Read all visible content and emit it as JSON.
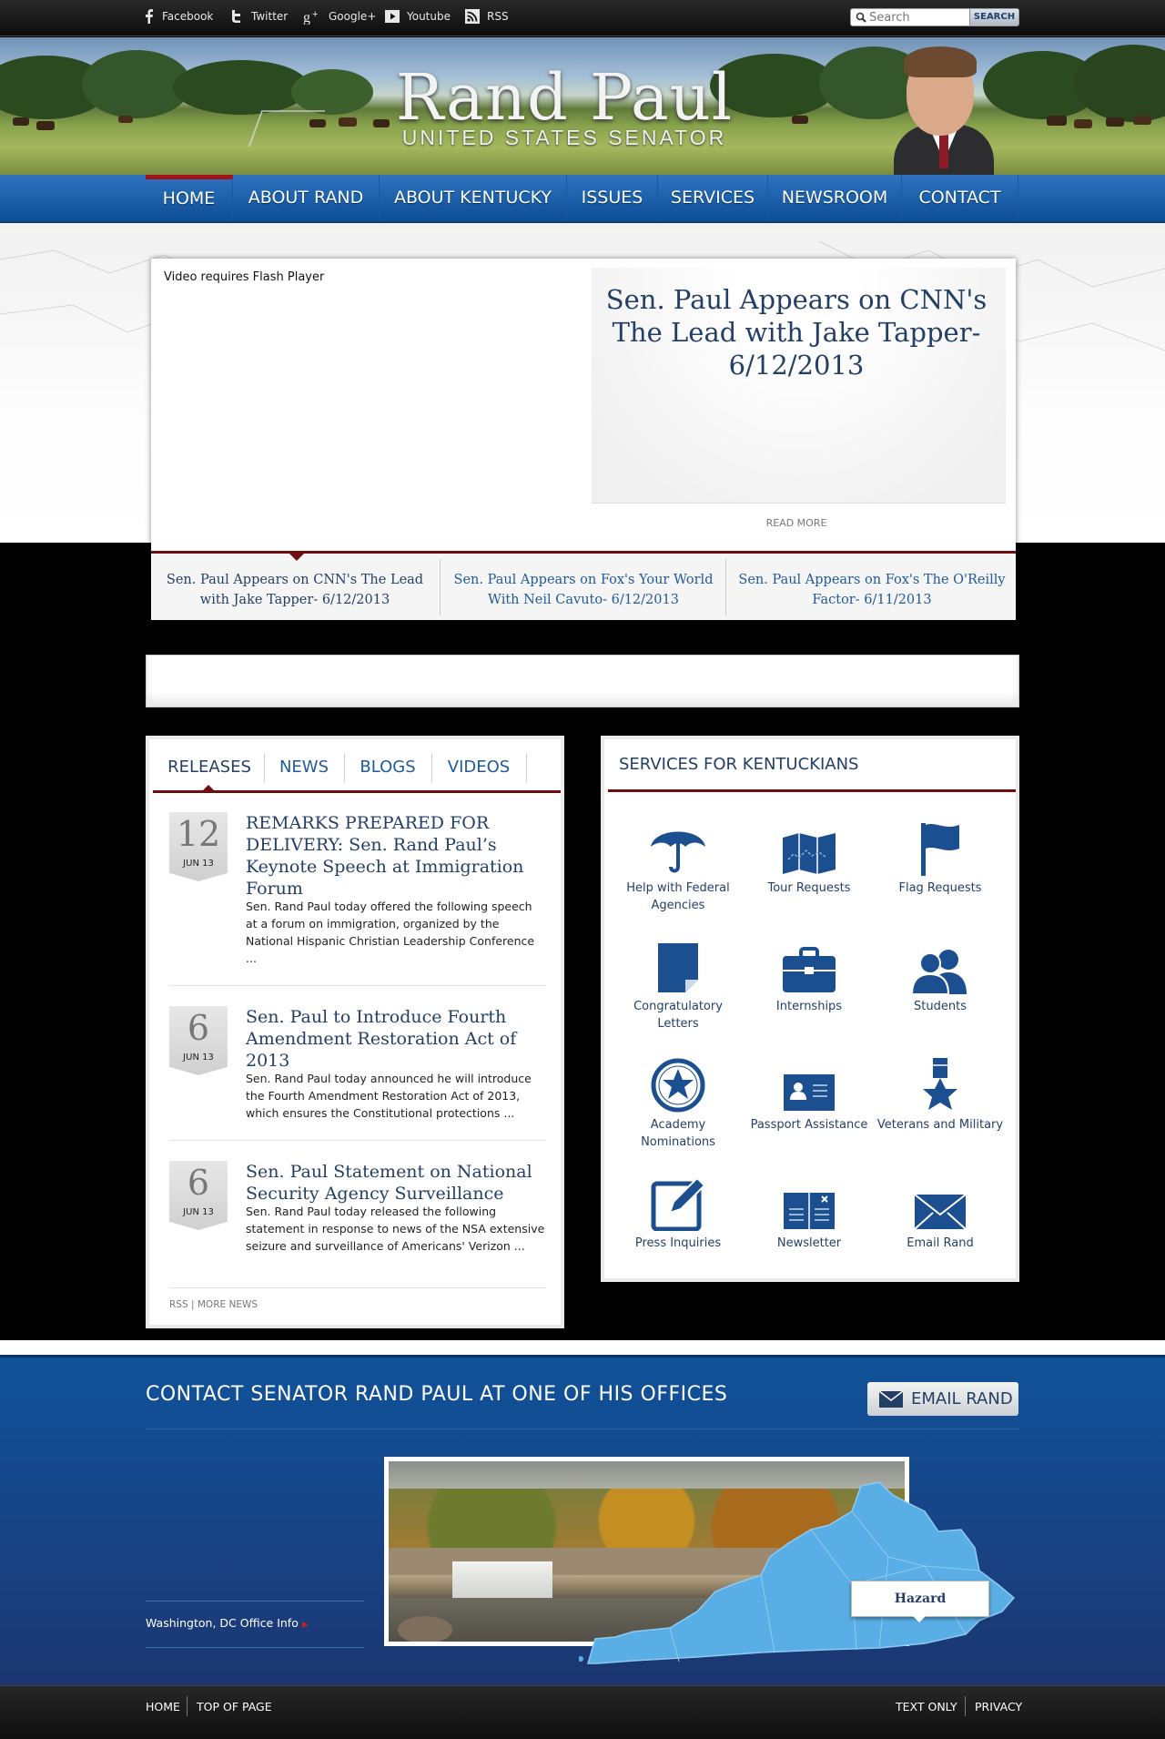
{
  "topbar": {
    "social": [
      {
        "label": "Facebook",
        "icon": "facebook-icon"
      },
      {
        "label": "Twitter",
        "icon": "twitter-icon"
      },
      {
        "label": "Google+",
        "icon": "google-plus-icon"
      },
      {
        "label": "Youtube",
        "icon": "youtube-icon"
      },
      {
        "label": "RSS",
        "icon": "rss-icon"
      }
    ],
    "search_placeholder": "Search",
    "search_button": "SEARCH"
  },
  "header": {
    "title": "Rand Paul",
    "subtitle": "UNITED STATES SENATOR"
  },
  "nav": {
    "items": [
      "HOME",
      "ABOUT RAND",
      "ABOUT KENTUCKY",
      "ISSUES",
      "SERVICES",
      "NEWSROOM",
      "CONTACT"
    ],
    "active": "HOME"
  },
  "feature": {
    "flash_notice": "Video requires Flash Player",
    "title": "Sen. Paul Appears on CNN's The Lead with Jake Tapper- 6/12/2013",
    "read_more": "READ MORE",
    "tabs": [
      "Sen. Paul Appears on CNN's The Lead with Jake Tapper- 6/12/2013",
      "Sen. Paul Appears on Fox's Your World With Neil Cavuto- 6/12/2013",
      "Sen. Paul Appears on Fox's The O'Reilly Factor- 6/11/2013"
    ]
  },
  "news": {
    "tabs": [
      "RELEASES",
      "NEWS",
      "BLOGS",
      "VIDEOS"
    ],
    "items": [
      {
        "day": "12",
        "month": "JUN 13",
        "title": "REMARKS PREPARED FOR DELIVERY: Sen. Rand Paul’s Keynote Speech at Immigration Forum",
        "summary": "Sen. Rand Paul today offered the following speech at a forum on immigration, organized by the National Hispanic Christian Leadership Conference ..."
      },
      {
        "day": "6",
        "month": "JUN 13",
        "title": "Sen. Paul to Introduce Fourth Amendment Restoration Act of 2013",
        "summary": "Sen. Rand Paul today announced he will introduce the Fourth Amendment Restoration Act of 2013, which ensures the Constitutional protections ..."
      },
      {
        "day": "6",
        "month": "JUN 13",
        "title": "Sen. Paul Statement on National Security Agency Surveillance",
        "summary": "Sen. Rand Paul today released the following statement in response to news of the NSA extensive seizure and surveillance of Americans' Verizon ..."
      }
    ],
    "rss": "RSS",
    "separator": "|",
    "more": "MORE NEWS"
  },
  "services": {
    "title": "SERVICES FOR KENTUCKIANS",
    "items": [
      {
        "label": "Help with Federal Agencies",
        "icon": "umbrella-icon"
      },
      {
        "label": "Tour Requests",
        "icon": "map-icon"
      },
      {
        "label": "Flag Requests",
        "icon": "flag-icon"
      },
      {
        "label": "Congratulatory Letters",
        "icon": "letter-icon"
      },
      {
        "label": "Internships",
        "icon": "briefcase-icon"
      },
      {
        "label": "Students",
        "icon": "students-icon"
      },
      {
        "label": "Academy Nominations",
        "icon": "star-icon"
      },
      {
        "label": "Passport Assistance",
        "icon": "passport-icon"
      },
      {
        "label": "Veterans and Military",
        "icon": "medal-icon"
      },
      {
        "label": "Press Inquiries",
        "icon": "pencil-icon"
      },
      {
        "label": "Newsletter",
        "icon": "newsletter-icon"
      },
      {
        "label": "Email Rand",
        "icon": "envelope-icon"
      }
    ]
  },
  "contact": {
    "title": "CONTACT SENATOR RAND PAUL AT ONE OF HIS OFFICES",
    "email_button": "EMAIL RAND",
    "office_link": "Washington, DC Office Info",
    "map_label": "Hazard"
  },
  "footer": {
    "left": [
      "HOME",
      "TOP OF PAGE"
    ],
    "right": [
      "TEXT ONLY",
      "PRIVACY"
    ]
  },
  "colors": {
    "brand_blue": "#10529a",
    "dark_red": "#6e0e10",
    "title_navy": "#243f66"
  }
}
